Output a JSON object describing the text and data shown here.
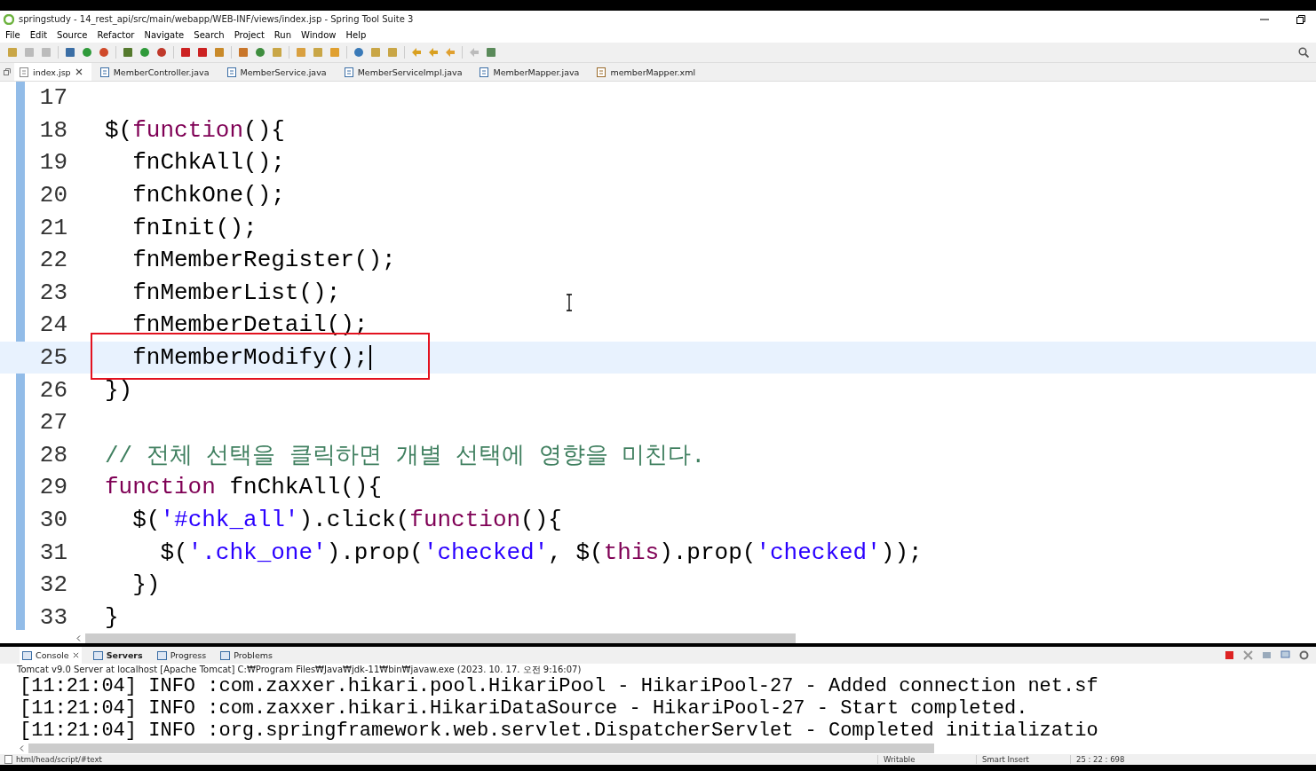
{
  "window": {
    "title": "springstudy - 14_rest_api/src/main/webapp/WEB-INF/views/index.jsp - Spring Tool Suite 3"
  },
  "menu": [
    "File",
    "Edit",
    "Source",
    "Refactor",
    "Navigate",
    "Search",
    "Project",
    "Run",
    "Window",
    "Help"
  ],
  "editor_tabs": [
    {
      "label": "index.jsp",
      "kind": "jsp",
      "selected": true
    },
    {
      "label": "MemberController.java",
      "kind": "java",
      "selected": false
    },
    {
      "label": "MemberService.java",
      "kind": "java",
      "selected": false
    },
    {
      "label": "MemberServiceImpl.java",
      "kind": "java",
      "selected": false
    },
    {
      "label": "MemberMapper.java",
      "kind": "java",
      "selected": false
    },
    {
      "label": "memberMapper.xml",
      "kind": "xml",
      "selected": false
    }
  ],
  "code_lines": [
    {
      "number": "17",
      "current": false
    },
    {
      "number": "18",
      "current": false,
      "tokens": [
        {
          "kind": "plain",
          "text": "$("
        },
        {
          "kind": "keyword",
          "text": "function"
        },
        {
          "kind": "plain",
          "text": "(){"
        }
      ]
    },
    {
      "number": "19",
      "current": false,
      "tokens": [
        {
          "kind": "plain",
          "text": "  fnChkAll();"
        }
      ]
    },
    {
      "number": "20",
      "current": false,
      "tokens": [
        {
          "kind": "plain",
          "text": "  fnChkOne();"
        }
      ]
    },
    {
      "number": "21",
      "current": false,
      "tokens": [
        {
          "kind": "plain",
          "text": "  fnInit();"
        }
      ]
    },
    {
      "number": "22",
      "current": false,
      "tokens": [
        {
          "kind": "plain",
          "text": "  fnMemberRegister();"
        }
      ]
    },
    {
      "number": "23",
      "current": false,
      "tokens": [
        {
          "kind": "plain",
          "text": "  fnMemberList();"
        }
      ]
    },
    {
      "number": "24",
      "current": false,
      "tokens": [
        {
          "kind": "plain",
          "text": "  fnMemberDetail();"
        }
      ]
    },
    {
      "number": "25",
      "current": true,
      "tokens": [
        {
          "kind": "plain",
          "text": "  fnMemberModify();"
        }
      ]
    },
    {
      "number": "26",
      "current": false,
      "tokens": [
        {
          "kind": "plain",
          "text": "})"
        }
      ]
    },
    {
      "number": "27",
      "current": false
    },
    {
      "number": "28",
      "current": false,
      "tokens": [
        {
          "kind": "comment",
          "text": "// 전체 선택을 클릭하면 개별 선택에 영향을 미친다."
        }
      ]
    },
    {
      "number": "29",
      "current": false,
      "tokens": [
        {
          "kind": "keyword",
          "text": "function"
        },
        {
          "kind": "plain",
          "text": " fnChkAll(){"
        }
      ]
    },
    {
      "number": "30",
      "current": false,
      "tokens": [
        {
          "kind": "plain",
          "text": "  $("
        },
        {
          "kind": "string",
          "text": "'#chk_all'"
        },
        {
          "kind": "plain",
          "text": ").click("
        },
        {
          "kind": "keyword",
          "text": "function"
        },
        {
          "kind": "plain",
          "text": "(){"
        }
      ]
    },
    {
      "number": "31",
      "current": false,
      "tokens": [
        {
          "kind": "plain",
          "text": "    $("
        },
        {
          "kind": "string",
          "text": "'.chk_one'"
        },
        {
          "kind": "plain",
          "text": ").prop("
        },
        {
          "kind": "string",
          "text": "'checked'"
        },
        {
          "kind": "plain",
          "text": ", $("
        },
        {
          "kind": "keyword",
          "text": "this"
        },
        {
          "kind": "plain",
          "text": ").prop("
        },
        {
          "kind": "string",
          "text": "'checked'"
        },
        {
          "kind": "plain",
          "text": "));"
        }
      ]
    },
    {
      "number": "32",
      "current": false,
      "tokens": [
        {
          "kind": "plain",
          "text": "  })"
        }
      ]
    },
    {
      "number": "33",
      "current": false,
      "tokens": [
        {
          "kind": "plain",
          "text": "}"
        }
      ]
    }
  ],
  "console_tabs": [
    {
      "label": "Console",
      "selected": true,
      "emphasized": false
    },
    {
      "label": "Servers",
      "selected": false,
      "emphasized": true
    },
    {
      "label": "Progress",
      "selected": false,
      "emphasized": false
    },
    {
      "label": "Problems",
      "selected": false,
      "emphasized": false
    }
  ],
  "console": {
    "process": "Tomcat v9.0 Server at localhost [Apache Tomcat] C:₩Program Files₩Java₩jdk-11₩bin₩javaw.exe  (2023. 10. 17. 오전 9:16:07)",
    "lines": [
      "[11:21:04] INFO :com.zaxxer.hikari.pool.HikariPool - HikariPool-27 - Added connection net.sf",
      "[11:21:04] INFO :com.zaxxer.hikari.HikariDataSource - HikariPool-27 - Start completed.",
      "[11:21:04] INFO :org.springframework.web.servlet.DispatcherServlet - Completed initializatio"
    ]
  },
  "status_bar": {
    "path": "html/head/script/#text",
    "mode": "Writable",
    "insert": "Smart Insert",
    "position": "25 : 22 : 698"
  }
}
